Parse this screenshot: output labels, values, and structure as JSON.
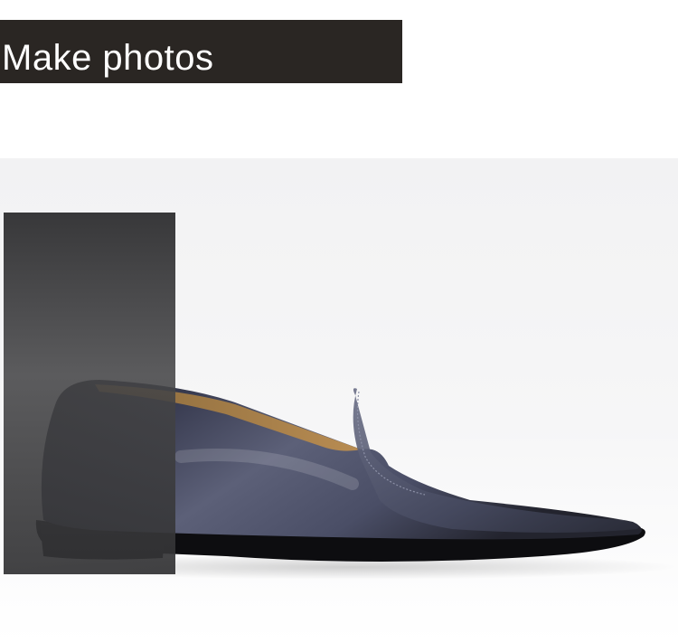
{
  "banner": {
    "title": "Make photos",
    "background_color": "#2a2623",
    "text_color": "#ffffff"
  },
  "photo": {
    "subject_icon": "loafer-shoe-icon",
    "shoe_color": "#3b3f55",
    "backdrop_color": "#f3f3f4"
  }
}
